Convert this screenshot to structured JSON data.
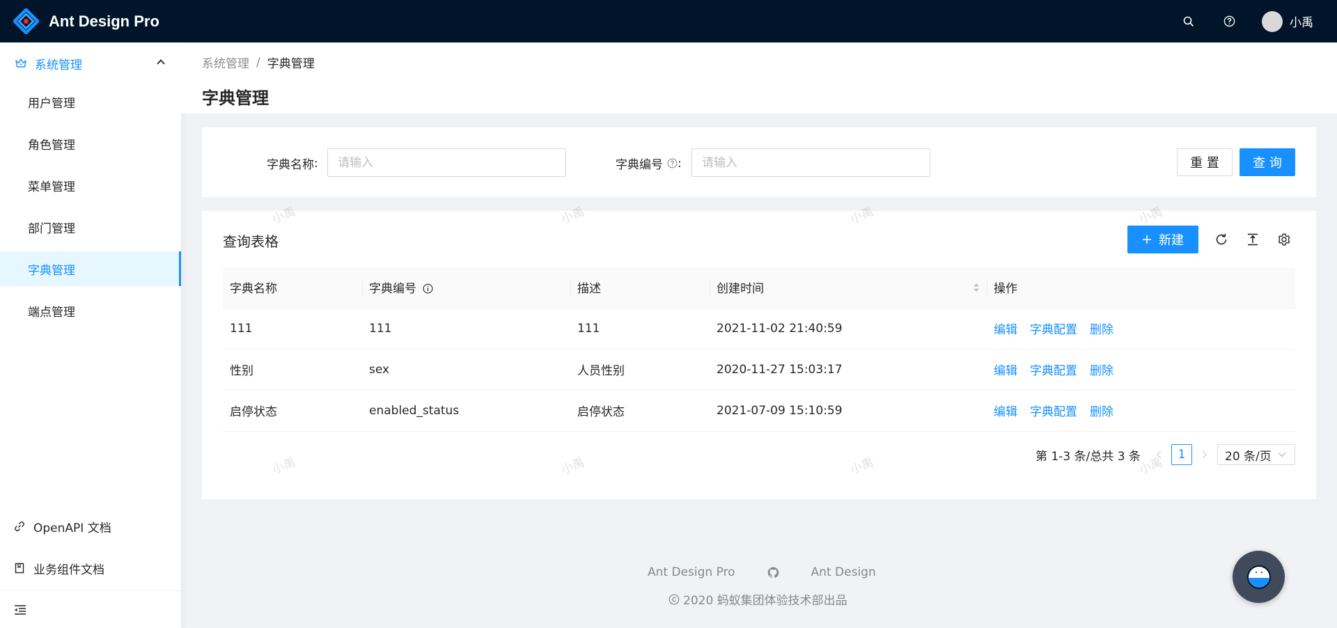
{
  "header": {
    "app_title": "Ant Design Pro",
    "user_name": "小禹"
  },
  "sidebar": {
    "group_label": "系统管理",
    "items": [
      {
        "label": "用户管理"
      },
      {
        "label": "角色管理"
      },
      {
        "label": "菜单管理"
      },
      {
        "label": "部门管理"
      },
      {
        "label": "字典管理",
        "active": true
      },
      {
        "label": "端点管理"
      }
    ],
    "links": [
      {
        "label": "OpenAPI 文档",
        "icon": "link-icon"
      },
      {
        "label": "业务组件文档",
        "icon": "book-icon"
      }
    ]
  },
  "breadcrumb": {
    "parent": "系统管理",
    "separator": "/",
    "current": "字典管理"
  },
  "page_title": "字典管理",
  "search": {
    "name_label": "字典名称",
    "name_placeholder": "请输入",
    "code_label": "字典编号",
    "code_placeholder": "请输入",
    "colon": ":",
    "reset_label": "重 置",
    "query_label": "查 询"
  },
  "table": {
    "title": "查询表格",
    "new_label": "新建",
    "columns": [
      "字典名称",
      "字典编号",
      "描述",
      "创建时间",
      "操作"
    ],
    "rows": [
      {
        "name": "111",
        "code": "111",
        "desc": "111",
        "created": "2021-11-02 21:40:59"
      },
      {
        "name": "性别",
        "code": "sex",
        "desc": "人员性别",
        "created": "2020-11-27 15:03:17"
      },
      {
        "name": "启停状态",
        "code": "enabled_status",
        "desc": "启停状态",
        "created": "2021-07-09 15:10:59"
      }
    ],
    "actions": {
      "edit": "编辑",
      "config": "字典配置",
      "delete": "删除"
    }
  },
  "pagination": {
    "summary": "第 1-3 条/总共 3 条",
    "current_page": "1",
    "page_size": "20 条/页"
  },
  "footer": {
    "link1": "Ant Design Pro",
    "link2": "Ant Design",
    "copyright": "2020 蚂蚁集团体验技术部出品"
  },
  "watermark": "小禹",
  "colors": {
    "header_bg": "#001529",
    "primary": "#1890ff",
    "active_bg": "#e6f7ff"
  }
}
